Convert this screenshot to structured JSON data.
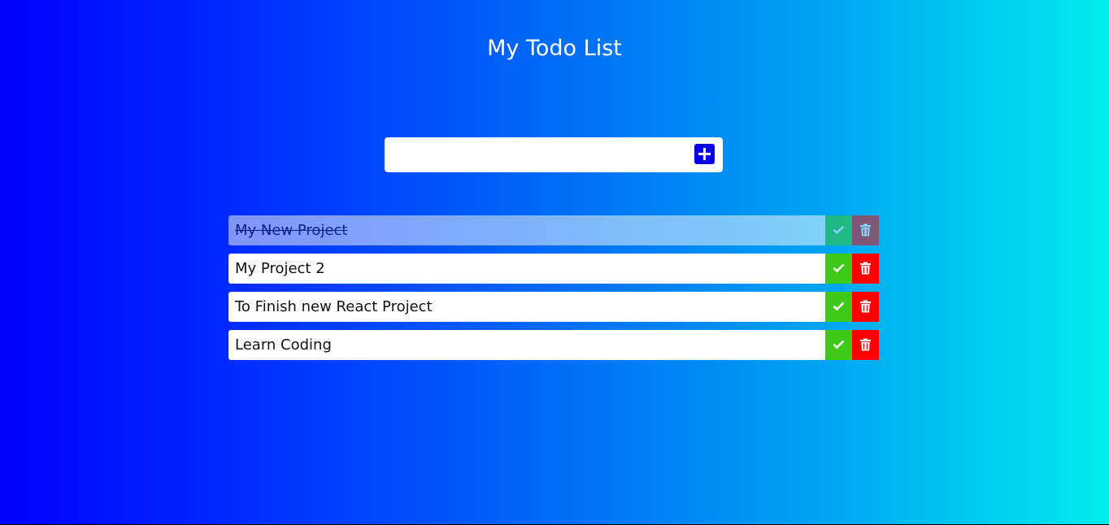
{
  "header": {
    "title": "My Todo List"
  },
  "add_form": {
    "input_value": "",
    "input_placeholder": "",
    "add_icon": "plus-square-icon"
  },
  "todos": [
    {
      "text": "My New Project",
      "completed": true,
      "check_icon": "check-icon",
      "delete_icon": "trash-icon"
    },
    {
      "text": "My Project 2",
      "completed": false,
      "check_icon": "check-icon",
      "delete_icon": "trash-icon"
    },
    {
      "text": "To Finish new React Project",
      "completed": false,
      "check_icon": "check-icon",
      "delete_icon": "trash-icon"
    },
    {
      "text": "Learn Coding",
      "completed": false,
      "check_icon": "check-icon",
      "delete_icon": "trash-icon"
    }
  ],
  "colors": {
    "gradient_start": "#0000ff",
    "gradient_end": "#00ecec",
    "add_button": "#0800e6",
    "complete_button": "#3fc919",
    "delete_button": "#ff0000"
  }
}
